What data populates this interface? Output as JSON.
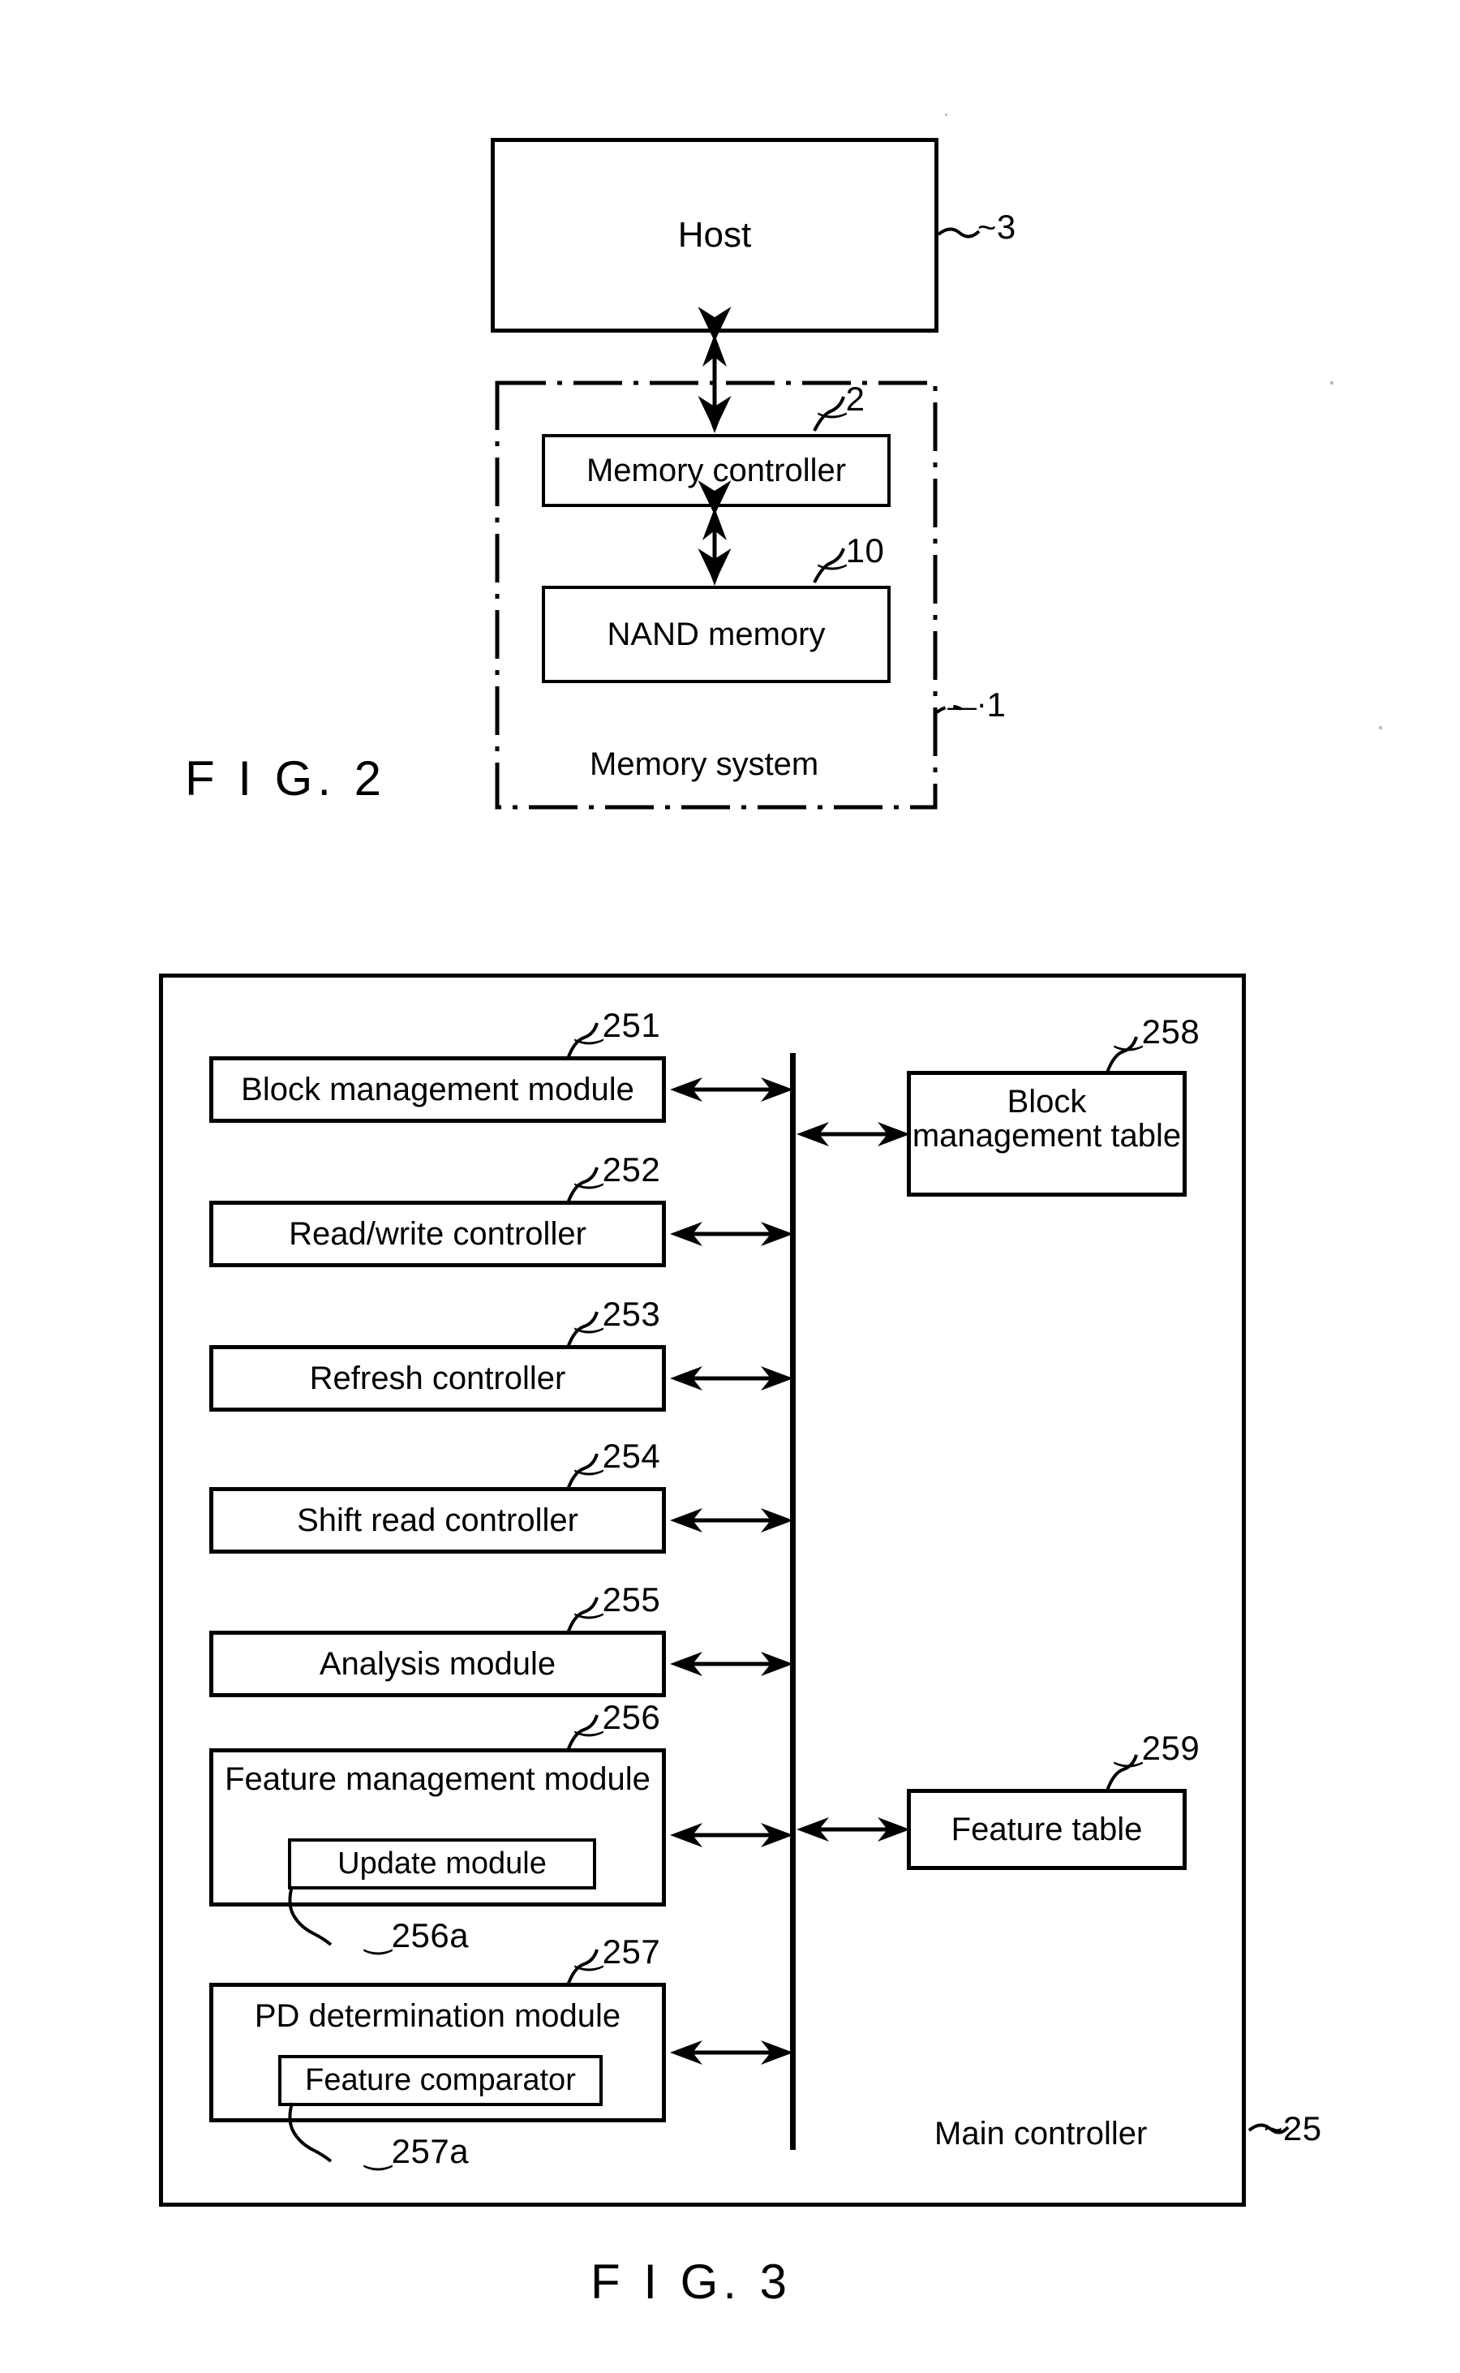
{
  "figures": [
    {
      "caption": "F I G. 2",
      "blocks": {
        "host": {
          "label": "Host",
          "ref": "3"
        },
        "memory_controller": {
          "label": "Memory controller",
          "ref": "2"
        },
        "nand_memory": {
          "label": "NAND memory",
          "ref": "10"
        },
        "memory_system": {
          "label": "Memory system",
          "ref": "1"
        }
      }
    },
    {
      "caption": "F I G. 3",
      "container": {
        "label": "Main controller",
        "ref": "25"
      },
      "modules": [
        {
          "label": "Block management module",
          "ref": "251"
        },
        {
          "label": "Read/write controller",
          "ref": "252"
        },
        {
          "label": "Refresh controller",
          "ref": "253"
        },
        {
          "label": "Shift read controller",
          "ref": "254"
        },
        {
          "label": "Analysis module",
          "ref": "255"
        },
        {
          "label": "Feature management module",
          "ref": "256",
          "child": {
            "label": "Update module",
            "ref": "256a"
          }
        },
        {
          "label": "PD determination module",
          "ref": "257",
          "child": {
            "label": "Feature comparator",
            "ref": "257a"
          }
        }
      ],
      "tables": [
        {
          "label": "Block management table",
          "ref": "258"
        },
        {
          "label": "Feature table",
          "ref": "259"
        }
      ]
    }
  ],
  "colors": {
    "ink": "#000000",
    "paper": "#ffffff"
  }
}
